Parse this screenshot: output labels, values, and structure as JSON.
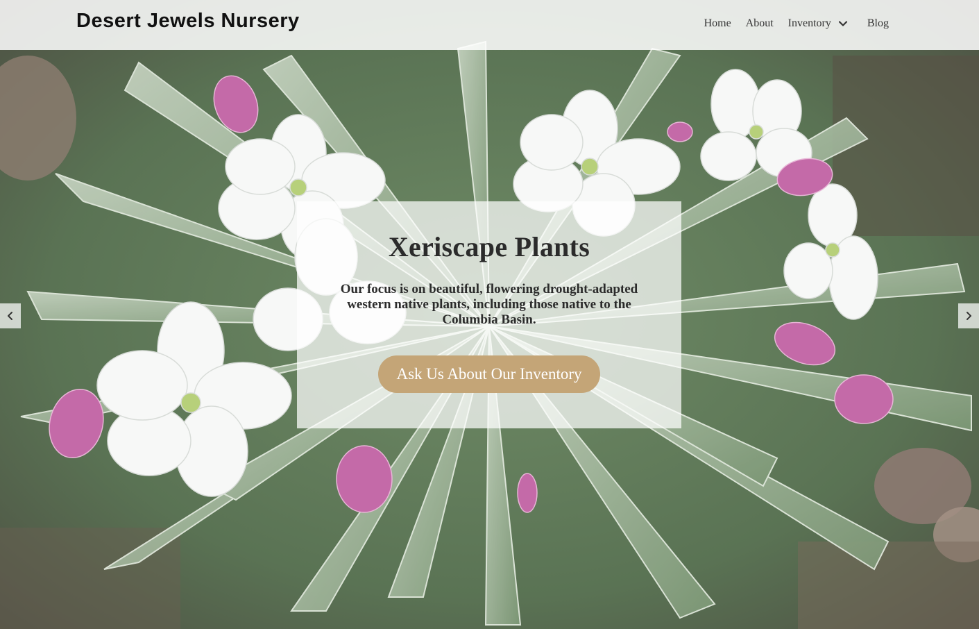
{
  "header": {
    "logo_text": "Desert Jewels Nursery",
    "nav": {
      "home": "Home",
      "about": "About",
      "inventory": "Inventory",
      "blog": "Blog"
    }
  },
  "hero": {
    "title": "Xeriscape Plants",
    "text": "Our focus is on beautiful, flowering drought-adapted western native plants, including those native to the Columbia Basin.",
    "cta_label": "Ask Us About Our Inventory"
  },
  "icons": {
    "dropdown": "chevron-down-icon",
    "prev": "chevron-left-icon",
    "next": "chevron-right-icon"
  },
  "colors": {
    "cta_background": "#c4a577",
    "cta_text": "#ffffff",
    "heading_text": "#2b2b2b",
    "header_background": "rgba(255,255,255,0.86)"
  }
}
